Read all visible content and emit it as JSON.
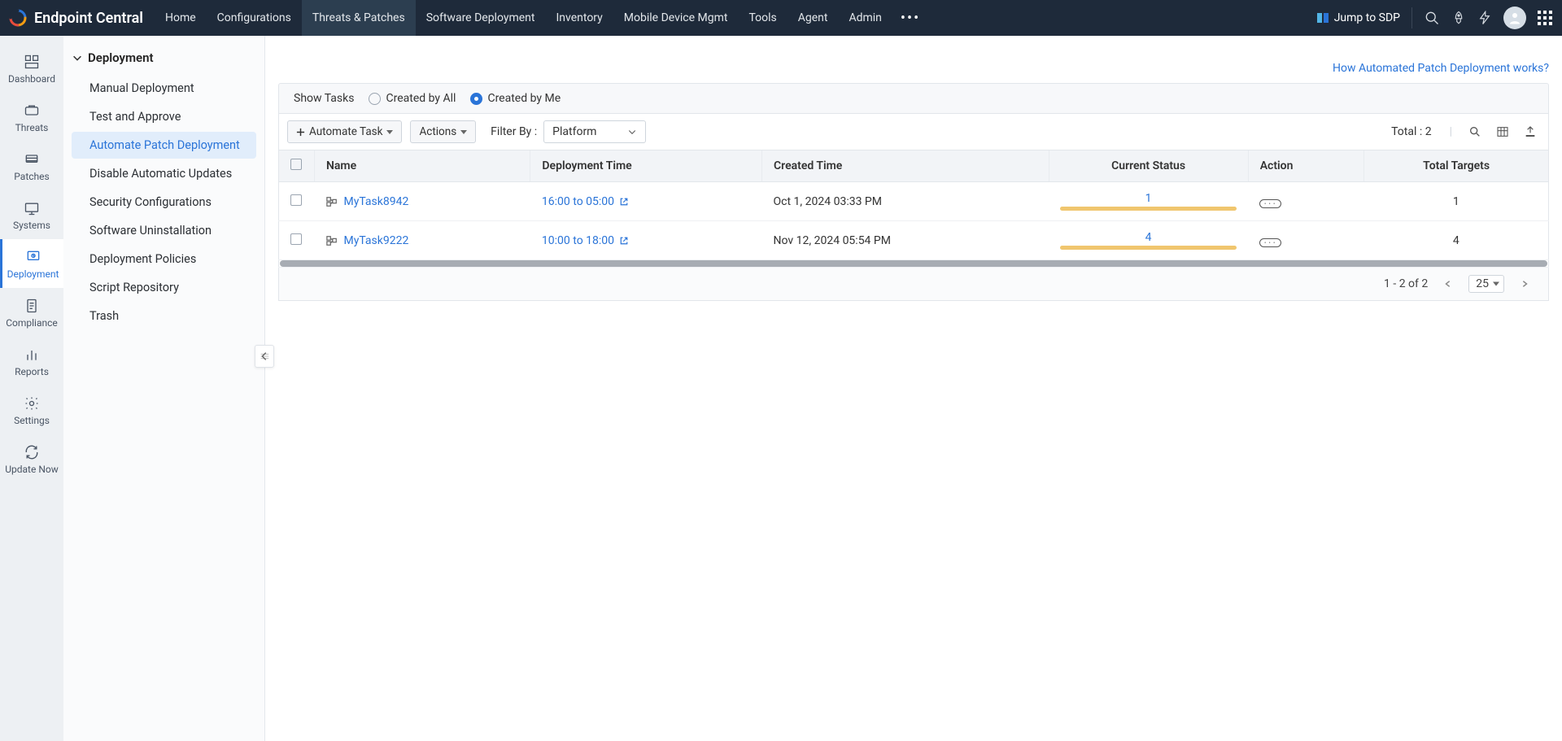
{
  "app_name": "Endpoint Central",
  "topnav": {
    "items": [
      "Home",
      "Configurations",
      "Threats & Patches",
      "Software Deployment",
      "Inventory",
      "Mobile Device Mgmt",
      "Tools",
      "Agent",
      "Admin"
    ],
    "active_index": 2,
    "jump_label": "Jump to SDP"
  },
  "rail": {
    "items": [
      "Dashboard",
      "Threats",
      "Patches",
      "Systems",
      "Deployment",
      "Compliance",
      "Reports",
      "Settings",
      "Update Now"
    ],
    "active_index": 4
  },
  "subnav": {
    "header": "Deployment",
    "items": [
      "Manual Deployment",
      "Test and Approve",
      "Automate Patch Deployment",
      "Disable Automatic Updates",
      "Security Configurations",
      "Software Uninstallation",
      "Deployment Policies",
      "Script Repository",
      "Trash"
    ],
    "active_index": 2
  },
  "help_link": "How Automated Patch Deployment works?",
  "filter_bar": {
    "show_tasks_label": "Show Tasks",
    "created_all_label": "Created by All",
    "created_me_label": "Created by Me",
    "selected": "me"
  },
  "toolbar": {
    "automate_button": "Automate Task",
    "actions_button": "Actions",
    "filter_by_label": "Filter By :",
    "platform_placeholder": "Platform",
    "total_label": "Total : 2"
  },
  "table": {
    "columns": [
      "Name",
      "Deployment Time",
      "Created Time",
      "Current Status",
      "Action",
      "Total Targets"
    ],
    "rows": [
      {
        "name": "MyTask8942",
        "deployment_time": "16:00 to 05:00",
        "created_time": "Oct 1, 2024 03:33 PM",
        "status_count": "1",
        "total_targets": "1"
      },
      {
        "name": "MyTask9222",
        "deployment_time": "10:00 to 18:00",
        "created_time": "Nov 12, 2024 05:54 PM",
        "status_count": "4",
        "total_targets": "4"
      }
    ]
  },
  "pager": {
    "range_label": "1 - 2 of 2",
    "page_size": "25"
  }
}
